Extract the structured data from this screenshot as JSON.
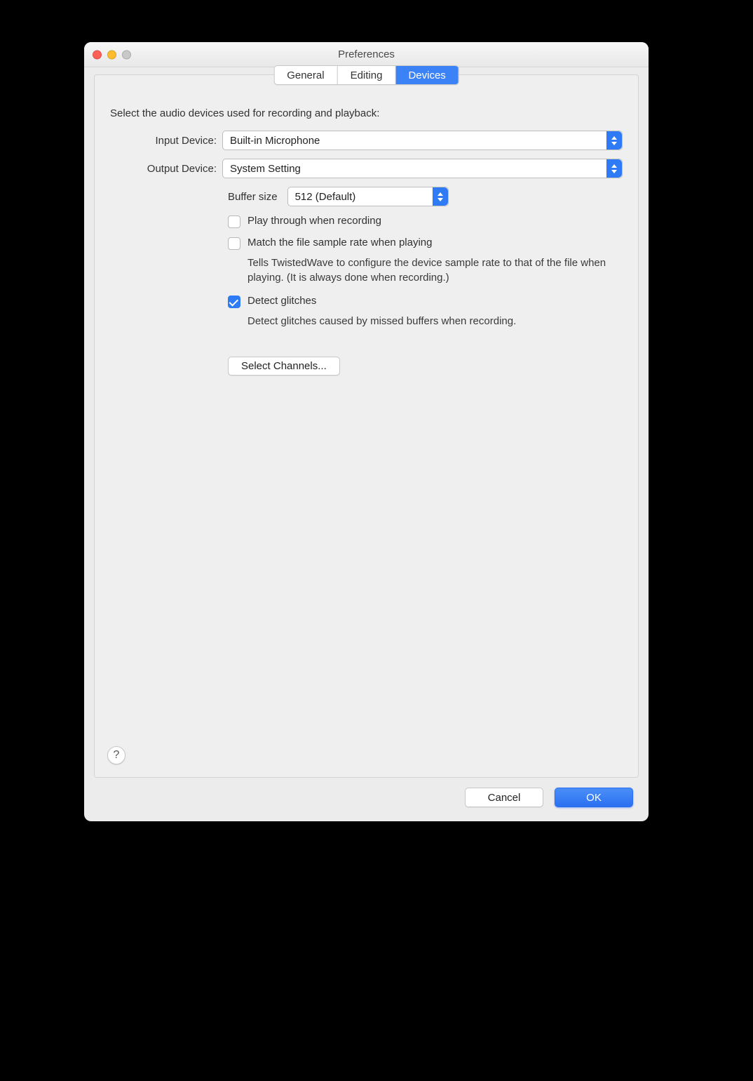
{
  "window": {
    "title": "Preferences"
  },
  "tabs": {
    "general": "General",
    "editing": "Editing",
    "devices": "Devices",
    "active": "devices"
  },
  "instruction": "Select the audio devices used for recording and playback:",
  "labels": {
    "input_device": "Input Device:",
    "output_device": "Output Device:",
    "buffer_size": "Buffer size"
  },
  "values": {
    "input_device": "Built-in Microphone",
    "output_device": "System Setting",
    "buffer_size": "512 (Default)"
  },
  "checkboxes": {
    "play_through": {
      "label": "Play through when recording",
      "checked": false
    },
    "match_rate": {
      "label": "Match the file sample rate when playing",
      "checked": false
    },
    "detect_glitches": {
      "label": "Detect glitches",
      "checked": true
    }
  },
  "help_texts": {
    "match_rate": "Tells TwistedWave to configure the device sample rate to that of the file when playing. (It is always done when recording.)",
    "detect_glitches": "Detect glitches caused by missed buffers when recording."
  },
  "buttons": {
    "select_channels": "Select Channels...",
    "help": "?",
    "cancel": "Cancel",
    "ok": "OK"
  }
}
